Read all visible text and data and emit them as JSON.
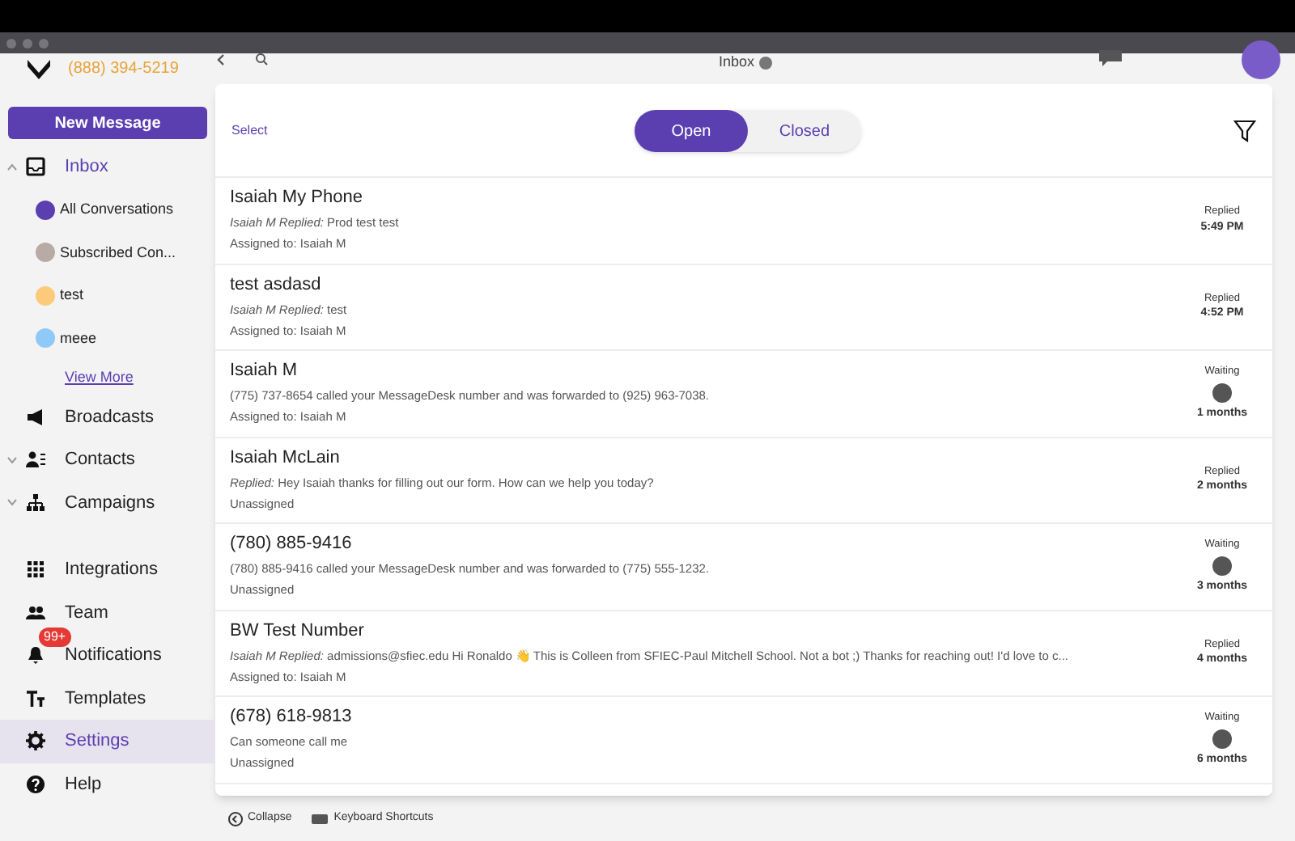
{
  "header": {
    "phone": "(888) 394-5219",
    "title": "Inbox"
  },
  "sidebar": {
    "new_message": "New Message",
    "items": [
      {
        "label": "Inbox",
        "expanded": true,
        "selected": false,
        "children": [
          {
            "label": "All Conversations",
            "color": "#5b3fb0"
          },
          {
            "label": "Subscribed Con...",
            "color": "#b8aba5"
          },
          {
            "label": "test",
            "color": "#fdc97a"
          },
          {
            "label": "meee",
            "color": "#8ec9f8"
          }
        ],
        "more": "View More"
      },
      {
        "label": "Broadcasts",
        "selected": false
      },
      {
        "label": "Contacts",
        "expanded": false,
        "selected": false
      },
      {
        "label": "Campaigns",
        "expanded": false,
        "selected": false
      },
      {
        "label": "Integrations",
        "selected": false
      },
      {
        "label": "Team",
        "selected": false
      },
      {
        "label": "Notifications",
        "selected": false,
        "badge": "99+"
      },
      {
        "label": "Templates",
        "selected": false
      },
      {
        "label": "Settings",
        "selected": true
      },
      {
        "label": "Help",
        "selected": false
      }
    ]
  },
  "toolbar": {
    "select": "Select",
    "tabs": [
      {
        "label": "Open",
        "selected": true
      },
      {
        "label": "Closed",
        "selected": false
      }
    ]
  },
  "conversations": [
    {
      "name": "Isaiah My Phone",
      "preview": "*Isaiah M Replied:* Prod test test",
      "assignment": "Assigned to: Isaiah M",
      "status": "Replied",
      "time": "5:49 PM",
      "kind": "replied"
    },
    {
      "name": "test asdasd",
      "preview": "*Isaiah M Replied:* test",
      "assignment": "Assigned to: Isaiah M",
      "status": "Replied",
      "time": "4:52 PM",
      "kind": "replied"
    },
    {
      "name": "Isaiah M",
      "preview": "(775) 737-8654 called your MessageDesk number and was forwarded to (925) 963-7038.",
      "assignment": "Assigned to: Isaiah M",
      "status": "Waiting",
      "time": "1 months",
      "kind": "waiting"
    },
    {
      "name": "Isaiah McLain",
      "preview": "*Replied:* Hey Isaiah thanks for filling out our form. How can we help you today?",
      "assignment": "Unassigned",
      "status": "Replied",
      "time": "2 months",
      "kind": "replied"
    },
    {
      "name": "(780) 885-9416",
      "preview": "(780) 885-9416 called your MessageDesk number and was forwarded to (775) 555-1232.",
      "assignment": "Unassigned",
      "status": "Waiting",
      "time": "3 months",
      "kind": "waiting"
    },
    {
      "name": "BW Test Number",
      "preview": "*Isaiah M Replied:* admissions@sfiec.edu Hi Ronaldo 👋 This is Colleen from SFIEC-Paul Mitchell School. Not a bot ;) Thanks for reaching out! I'd love to c...",
      "assignment": "Assigned to: Isaiah M",
      "status": "Replied",
      "time": "4 months",
      "kind": "replied"
    },
    {
      "name": "(678) 618-9813",
      "preview": "Can someone call me",
      "assignment": "Unassigned",
      "status": "Waiting",
      "time": "6 months",
      "kind": "waiting"
    }
  ],
  "footer": {
    "collapse": "Collapse",
    "shortcuts": "Keyboard Shortcuts"
  }
}
